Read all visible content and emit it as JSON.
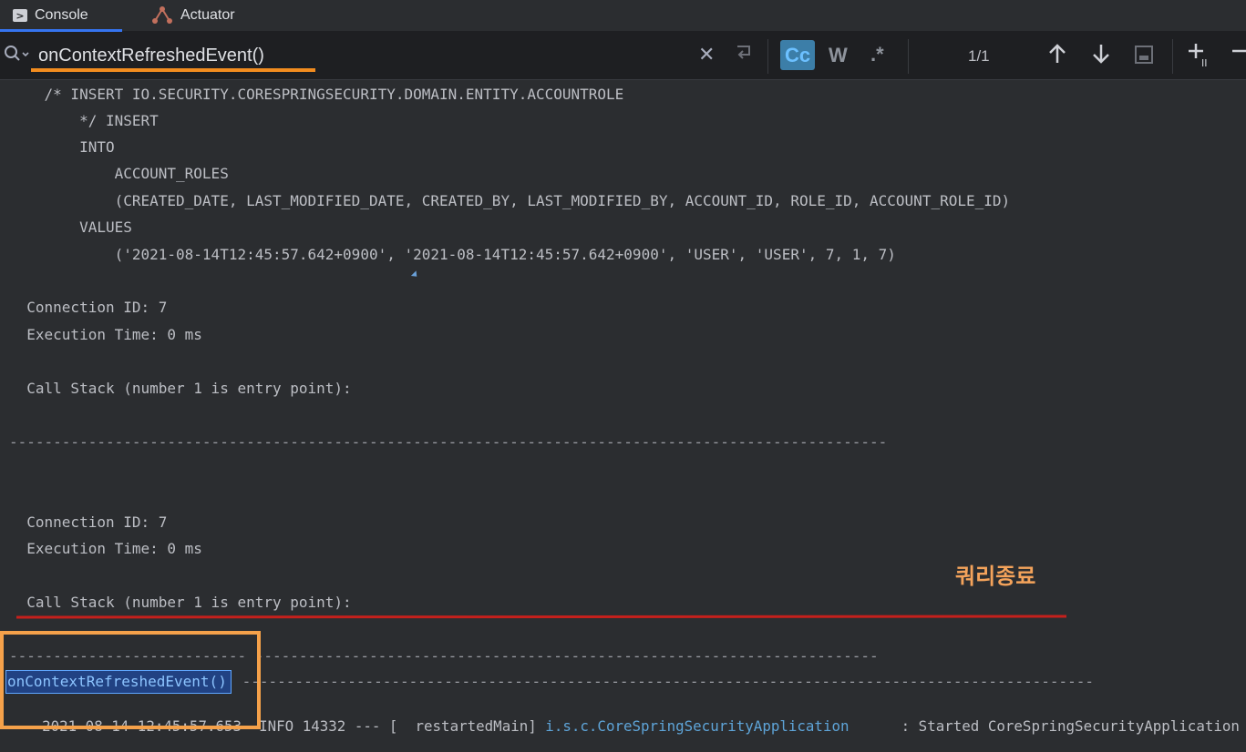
{
  "tabs": [
    {
      "label": "Console",
      "icon": "console-icon",
      "active": true
    },
    {
      "label": "Actuator",
      "icon": "actuator-icon",
      "active": false
    }
  ],
  "search": {
    "value": "onContextRefreshedEvent()",
    "match_case_label": "Cc",
    "words_label": "W",
    "regex_label": ".*",
    "match_count": "1/1"
  },
  "console": {
    "lines": [
      "    /* INSERT IO.SECURITY.CORESPRINGSECURITY.DOMAIN.ENTITY.ACCOUNTROLE",
      "        */ INSERT",
      "        INTO",
      "            ACCOUNT_ROLES",
      "            (CREATED_DATE, LAST_MODIFIED_DATE, CREATED_BY, LAST_MODIFIED_BY, ACCOUNT_ID, ROLE_ID, ACCOUNT_ROLE_ID)",
      "        VALUES",
      "            ('2021-08-14T12:45:57.642+0900', '2021-08-14T12:45:57.642+0900', 'USER', 'USER', 7, 1, 7)",
      "  Connection ID: 7",
      "  Execution Time: 0 ms",
      "  Call Stack (number 1 is entry point):",
      "----------------------------------------------------------------------------------------------------",
      "  Connection ID: 7",
      "  Execution Time: 0 ms",
      "  Call Stack (number 1 is entry point):",
      "--------------------------- -----------------------------------------------------------------------"
    ],
    "event_match": "onContextRefreshedEvent()",
    "event_tail": " -------------------------------------------------------------------------------------------------",
    "log": {
      "timestamp": "2021-08-14 12:45:57.653",
      "level": "INFO",
      "pid": "14332",
      "sep": "---",
      "thread": "[  restartedMain]",
      "logger": "i.s.c.CoreSpringSecurityApplication",
      "message": ": Started CoreSpringSecurityApplication"
    }
  },
  "annotation": {
    "note": "쿼리종료",
    "colors": {
      "note": "#f4a35b",
      "underline": "#c5201c",
      "box": "#f5a14a",
      "search_underline": "#f28c1f"
    }
  }
}
